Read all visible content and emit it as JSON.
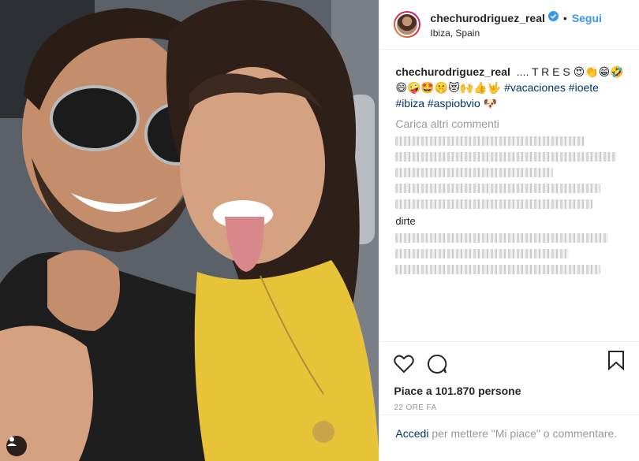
{
  "post": {
    "username": "chechurodriguez_real",
    "follow_label": "Segui",
    "dot": "•",
    "location": "Ibiza, Spain",
    "caption_user": "chechurodriguez_real",
    "caption_text": ".... T R E S 😍👏😁🤣😄🤪🤩🤫😻🙌👍🤟",
    "hashtags": [
      "#vacaciones",
      "#ioete",
      "#ibiza",
      "#aspiobvio"
    ],
    "caption_end": "🐶",
    "load_more": "Carica altri commenti",
    "visible_comment_word": "dirte",
    "likes_prefix": "Piace a",
    "likes_count": "101.870",
    "likes_suffix": "persone",
    "time": "22 ORE FA",
    "login_link": "Accedi",
    "login_text": "per mettere \"Mi piace\" o commentare."
  },
  "colors": {
    "link_blue": "#3897f0",
    "hashtag_blue": "#003569",
    "muted": "#999999",
    "text": "#262626"
  },
  "icons": [
    "verified-badge-icon",
    "heart-icon",
    "comment-icon",
    "bookmark-icon",
    "user-tag-icon"
  ]
}
